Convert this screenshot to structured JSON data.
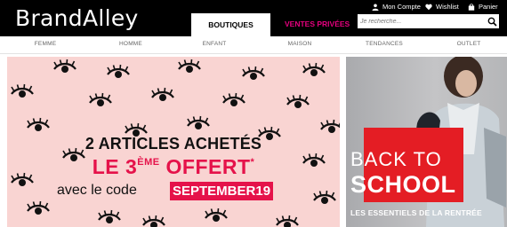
{
  "header": {
    "logo": "BrandAlley",
    "tabs": {
      "boutiques": "BOUTIQUES",
      "ventes_privees": "VENTES PRIVÉES"
    },
    "account": {
      "mon_compte": "Mon Compte",
      "wishlist": "Wishlist",
      "panier": "Panier"
    },
    "search": {
      "placeholder": "Je recherche..."
    }
  },
  "categories": [
    "FEMME",
    "HOMME",
    "ENFANT",
    "MAISON",
    "TENDANCES",
    "OUTLET"
  ],
  "promo": {
    "line1": "2 ARTICLES ACHETÉS",
    "line2_pre": "LE 3",
    "line2_sup": "ÈME",
    "line2_post": " OFFERT",
    "line2_mark": "*",
    "line3": "avec le code",
    "code": "SEPTEMBER19"
  },
  "school_banner": {
    "title1": "BACK TO",
    "title2": "SCHOOL",
    "subtitle": "LES ESSENTIELS DE LA RENTRÉE"
  },
  "colors": {
    "accent_pink": "#e6007e",
    "promo_bg": "#f9d4d2",
    "promo_red": "#e5124a",
    "school_red": "#e41d24"
  }
}
